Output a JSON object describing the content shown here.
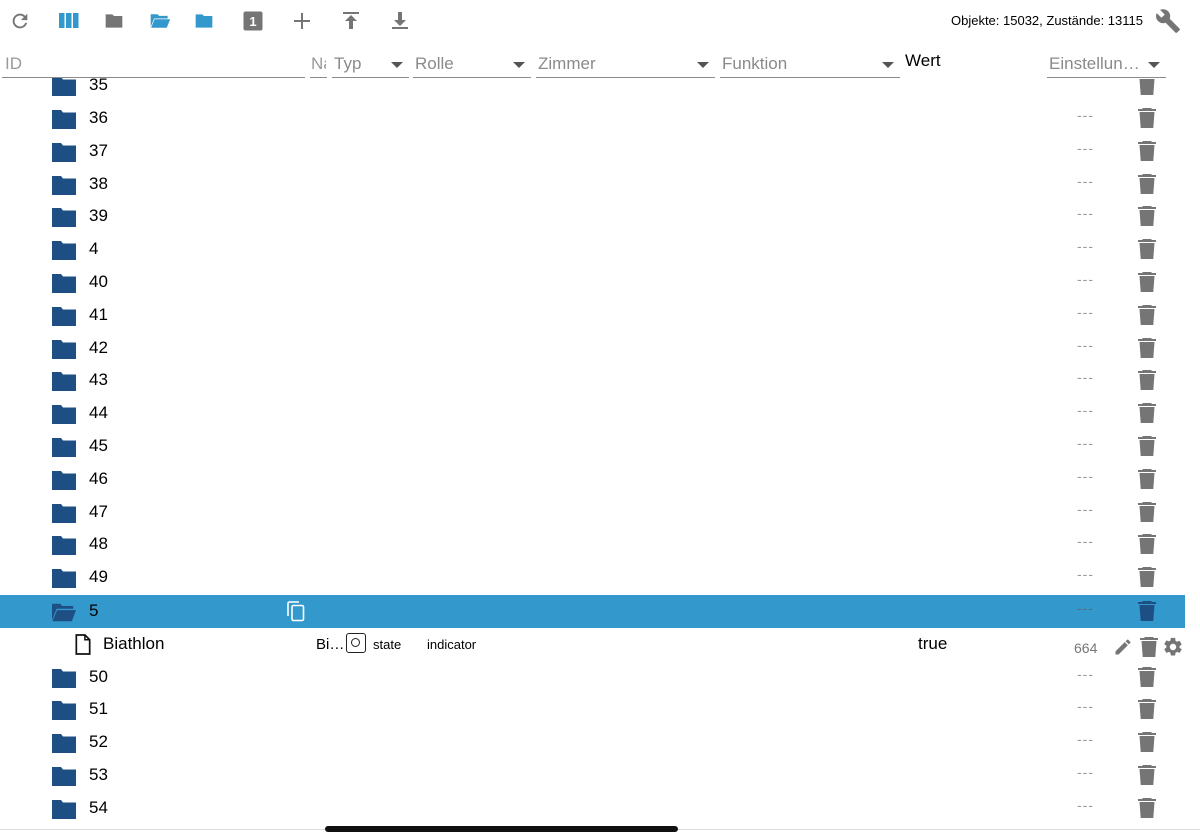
{
  "toolbar": {
    "icons": [
      "refresh-icon",
      "columns-icon",
      "folder-icon",
      "folder-open-icon",
      "folder-blue-icon",
      "number-one-icon",
      "plus-icon",
      "upload-icon",
      "download-icon"
    ],
    "counts": "Objekte: 15032, Zustände: 13115",
    "settings_icon": "wrench-icon",
    "number_badge": "1"
  },
  "filters": {
    "id_placeholder": "ID",
    "name_placeholder": "Name",
    "typ": "Typ",
    "rolle": "Rolle",
    "zimmer": "Zimmer",
    "funktion": "Funktion",
    "wert": "Wert",
    "einstellungen": "Einstellun…"
  },
  "colors": {
    "folder": "#1d4f85",
    "selected_row": "#3399cc",
    "icon_gray": "#757575",
    "toolbar_blue": "#3399cc"
  },
  "rows_before": [
    {
      "name": "35",
      "dash": ""
    },
    {
      "name": "36",
      "dash": "---"
    },
    {
      "name": "37",
      "dash": "---"
    },
    {
      "name": "38",
      "dash": "---"
    },
    {
      "name": "39",
      "dash": "---"
    },
    {
      "name": "4",
      "dash": "---"
    },
    {
      "name": "40",
      "dash": "---"
    },
    {
      "name": "41",
      "dash": "---"
    },
    {
      "name": "42",
      "dash": "---"
    },
    {
      "name": "43",
      "dash": "---"
    },
    {
      "name": "44",
      "dash": "---"
    },
    {
      "name": "45",
      "dash": "---"
    },
    {
      "name": "46",
      "dash": "---"
    },
    {
      "name": "47",
      "dash": "---"
    },
    {
      "name": "48",
      "dash": "---"
    },
    {
      "name": "49",
      "dash": "---"
    }
  ],
  "selected_row": {
    "name": "5",
    "dash": "---"
  },
  "state_row": {
    "name": "Biathlon",
    "short_name": "Bi…",
    "type": "state",
    "role": "indicator",
    "value": "true",
    "number": "664"
  },
  "rows_after": [
    {
      "name": "50",
      "dash": "---"
    },
    {
      "name": "51",
      "dash": "---"
    },
    {
      "name": "52",
      "dash": "---"
    },
    {
      "name": "53",
      "dash": "---"
    },
    {
      "name": "54",
      "dash": "---"
    }
  ]
}
